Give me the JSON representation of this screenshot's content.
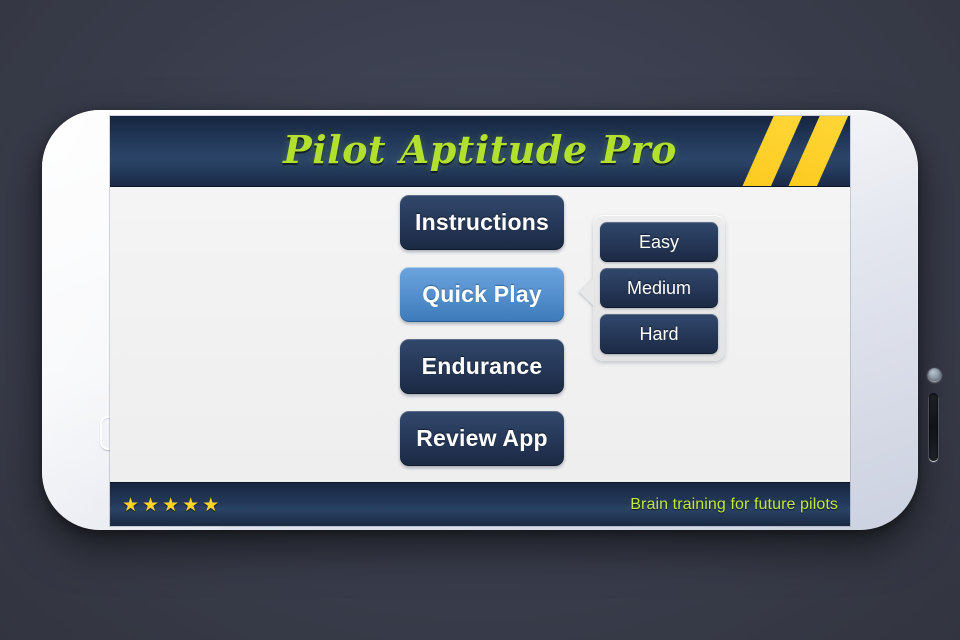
{
  "background": {
    "color": "#3b3f4f"
  },
  "device": {
    "frame_color": "#eef0f5",
    "home_button_name": "home-button",
    "camera_name": "front-camera",
    "speaker_name": "earpiece-speaker"
  },
  "app": {
    "header": {
      "title": "Pilot Aptitude Pro",
      "title_color": "#b2e02e",
      "background_color": "#25395a",
      "stripe_color": "#ffd21e",
      "stripe_count": 2
    },
    "main_menu": {
      "items": [
        {
          "label": "Instructions",
          "selected": false
        },
        {
          "label": "Quick Play",
          "selected": true
        },
        {
          "label": "Endurance",
          "selected": false
        },
        {
          "label": "Review App",
          "selected": false
        }
      ],
      "selected_color": "#5691cf",
      "default_color": "#27395a"
    },
    "difficulty_menu": {
      "visible": true,
      "attached_to": "Quick Play",
      "panel_color": "#e8e8e8",
      "options": [
        {
          "label": "Easy"
        },
        {
          "label": "Medium"
        },
        {
          "label": "Hard"
        }
      ]
    },
    "footer": {
      "rating": {
        "stars_filled": 5,
        "star_glyph": "★",
        "star_color": "#ffd426"
      },
      "tagline": "Brain training for future pilots",
      "tagline_color": "#c2e83a",
      "background_color": "#24395a"
    },
    "screen": {
      "background_color": "#f0f0f0"
    }
  }
}
